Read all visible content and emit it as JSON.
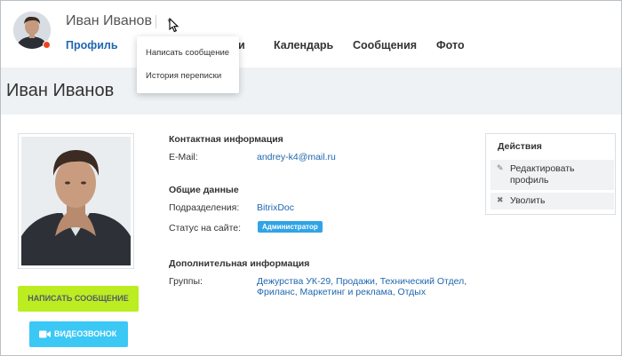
{
  "header": {
    "user_name": "Иван Иванов",
    "status_color": "#f0411f"
  },
  "nav": {
    "items": [
      {
        "label": "Профиль",
        "active": true
      },
      {
        "label": "и",
        "active": false
      },
      {
        "label": "Календарь",
        "active": false
      },
      {
        "label": "Сообщения",
        "active": false
      },
      {
        "label": "Фото",
        "active": false
      }
    ],
    "active_color": "#2067b0"
  },
  "dropdown": {
    "items": [
      "Написать сообщение",
      "История переписки"
    ]
  },
  "page": {
    "title": "Иван Иванов"
  },
  "left": {
    "message_button": "НАПИСАТЬ СООБЩЕНИЕ",
    "video_button": "ВИДЕОЗВОНОК",
    "message_color": "#bbed21",
    "video_color": "#3bc8f5"
  },
  "info": {
    "contact_title": "Контактная информация",
    "email_label": "E-Mail:",
    "email_value": "andrey-k4@mail.ru",
    "general_title": "Общие данные",
    "department_label": "Подразделения:",
    "department_value": "BitrixDoc",
    "status_label": "Статус на сайте:",
    "status_value": "Администратор",
    "extra_title": "Дополнительная информация",
    "groups_label": "Группы:",
    "groups_line1": "Дежурства УК-29, Продажи, Технический Отдел,",
    "groups_line2": "Фриланс, Маркетинг и реклама, Отдых"
  },
  "actions": {
    "title": "Действия",
    "edit_line1": "Редактировать",
    "edit_line2": "профиль",
    "fire": "Уволить"
  }
}
